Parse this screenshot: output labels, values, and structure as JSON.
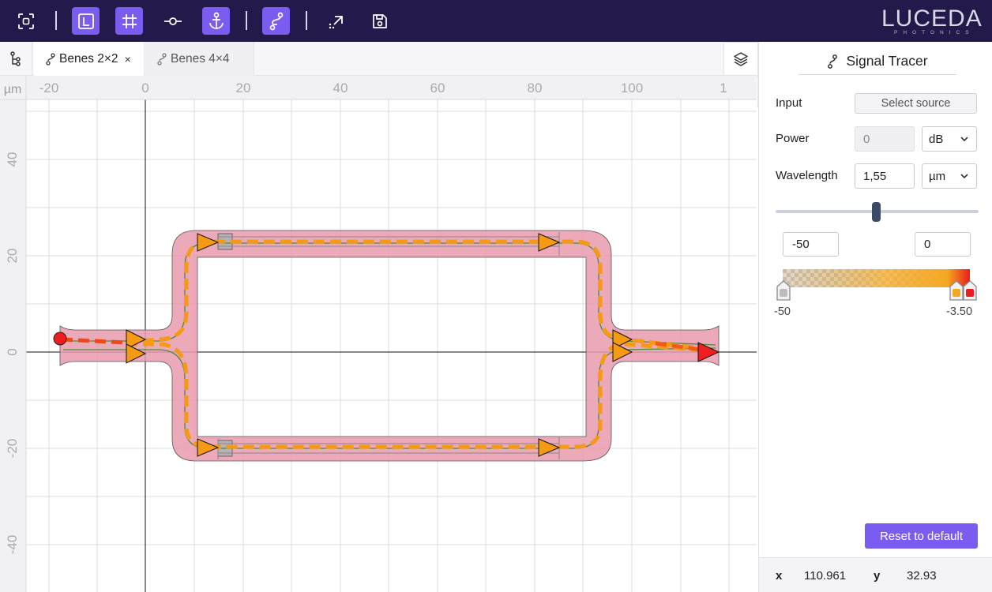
{
  "app": {
    "brand": "LUCEDA",
    "brand_sub": "PHOTONICS",
    "accent_color": "#7b5cf0",
    "toolbar_bg": "#23194a"
  },
  "toolbar": {
    "buttons": [
      {
        "name": "fit-view-icon",
        "active": false
      },
      {
        "name": "layer-L-icon",
        "active": true
      },
      {
        "name": "grid-icon",
        "active": true
      },
      {
        "name": "port-icon",
        "active": false
      },
      {
        "name": "anchor-icon",
        "active": true
      },
      {
        "name": "signal-tracer-icon",
        "active": true
      },
      {
        "name": "export-icon",
        "active": false
      },
      {
        "name": "save-icon",
        "active": false
      }
    ]
  },
  "tabs": [
    {
      "label": "Benes 2×2",
      "active": true,
      "close": "×"
    },
    {
      "label": "Benes 4×4",
      "active": false
    }
  ],
  "canvas": {
    "unit": "µm",
    "x_ticks": [
      "-20",
      "0",
      "20",
      "40",
      "60",
      "80",
      "100",
      "1"
    ],
    "y_ticks": [
      "40",
      "20",
      "0",
      "-20",
      "-40"
    ]
  },
  "panel": {
    "title": "Signal Tracer",
    "input_label": "Input",
    "select_source": "Select source",
    "power_label": "Power",
    "power_value": "0",
    "power_unit": "dB",
    "wavelength_label": "Wavelength",
    "wavelength_value": "1,55",
    "wavelength_unit": "µm",
    "wavelength_slider_fraction": 0.5,
    "range_min_value": "-50",
    "range_max_value": "0",
    "scale_min_label": "-50",
    "scale_max_label": "-3.50",
    "reset_label": "Reset to default"
  },
  "coords": {
    "x_label": "x",
    "x_value": "110.961",
    "y_label": "y",
    "y_value": "32.93"
  }
}
